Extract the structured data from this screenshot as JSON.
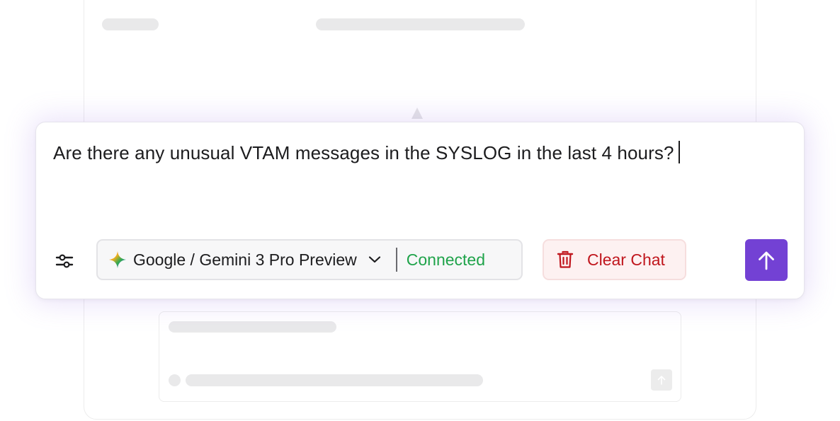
{
  "prompt": {
    "text": "Are there any unusual VTAM messages in the SYSLOG in the last 4 hours?"
  },
  "toolbar": {
    "settings_icon": "sliders-icon",
    "model": {
      "icon": "gemini-star-icon",
      "label": "Google / Gemini 3 Pro Preview",
      "dropdown_icon": "chevron-down-icon"
    },
    "status": {
      "label": "Connected",
      "color": "#1fa34a"
    },
    "clear": {
      "icon": "trash-icon",
      "label": "Clear Chat",
      "color": "#c0161d"
    },
    "send": {
      "icon": "arrow-up-icon",
      "color": "#7341d4"
    }
  }
}
